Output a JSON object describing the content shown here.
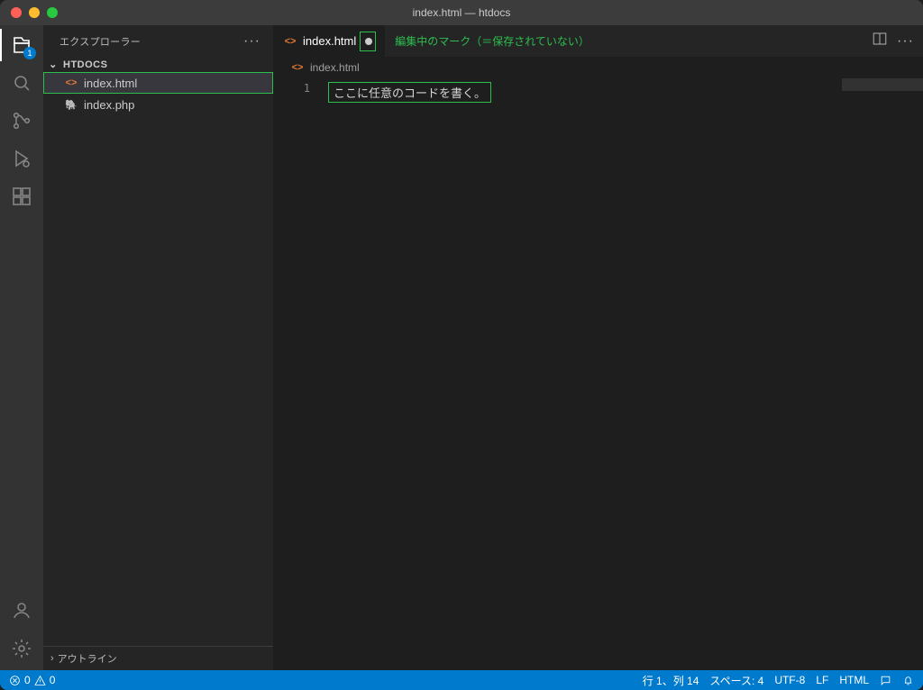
{
  "window": {
    "title": "index.html — htdocs"
  },
  "activity": {
    "explorer_badge": "1"
  },
  "sidebar": {
    "title": "エクスプローラー",
    "folder": "HTDOCS",
    "files": [
      {
        "name": "index.html",
        "kind": "html",
        "selected": true,
        "highlight": true
      },
      {
        "name": "index.php",
        "kind": "php",
        "selected": false,
        "highlight": false
      }
    ],
    "outline": "アウトライン"
  },
  "tabs": {
    "active": {
      "name": "index.html",
      "dirty": true
    },
    "dirty_annotation": "編集中のマーク（＝保存されていない）"
  },
  "breadcrumb": {
    "file": "index.html"
  },
  "editor": {
    "line_number": "1",
    "content": "ここに任意のコードを書く。"
  },
  "status": {
    "errors": "0",
    "warnings": "0",
    "cursor": "行 1、列 14",
    "spaces": "スペース: 4",
    "encoding": "UTF-8",
    "eol": "LF",
    "language": "HTML"
  }
}
